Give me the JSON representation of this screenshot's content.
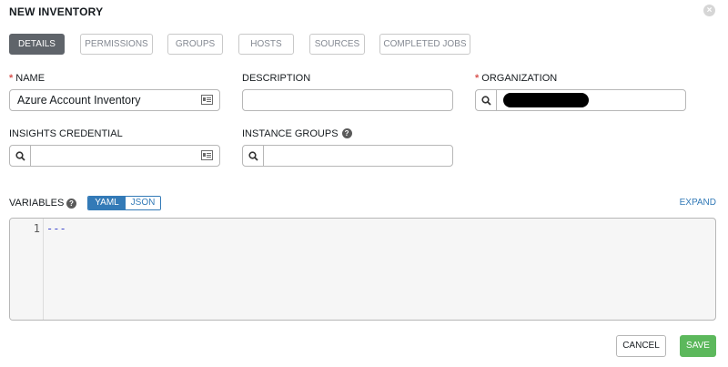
{
  "header": {
    "title": "NEW INVENTORY",
    "close_icon": "close-icon"
  },
  "tabs": [
    {
      "label": "DETAILS",
      "active": true
    },
    {
      "label": "PERMISSIONS",
      "active": false
    },
    {
      "label": "GROUPS",
      "active": false
    },
    {
      "label": "HOSTS",
      "active": false
    },
    {
      "label": "SOURCES",
      "active": false
    },
    {
      "label": "COMPLETED JOBS",
      "active": false
    }
  ],
  "form": {
    "name": {
      "label": "NAME",
      "required": true,
      "value": "Azure Account Inventory"
    },
    "description": {
      "label": "DESCRIPTION",
      "value": ""
    },
    "organization": {
      "label": "ORGANIZATION",
      "required": true,
      "value_redacted": true
    },
    "insights_credential": {
      "label": "INSIGHTS CREDENTIAL",
      "value": ""
    },
    "instance_groups": {
      "label": "INSTANCE GROUPS",
      "value": ""
    },
    "required_marker": "*"
  },
  "variables": {
    "label": "VARIABLES",
    "help_icon_glyph": "?",
    "toggle": {
      "yaml": "YAML",
      "json": "JSON",
      "selected": "YAML"
    },
    "expand_label": "EXPAND",
    "editor": {
      "line_number": "1",
      "content": "---"
    }
  },
  "actions": {
    "cancel_label": "CANCEL",
    "save_label": "SAVE"
  },
  "colors": {
    "accent_blue": "#337ab7",
    "save_green": "#5cb85c",
    "required_red": "#d9534f",
    "active_tab": "#5f646a"
  }
}
